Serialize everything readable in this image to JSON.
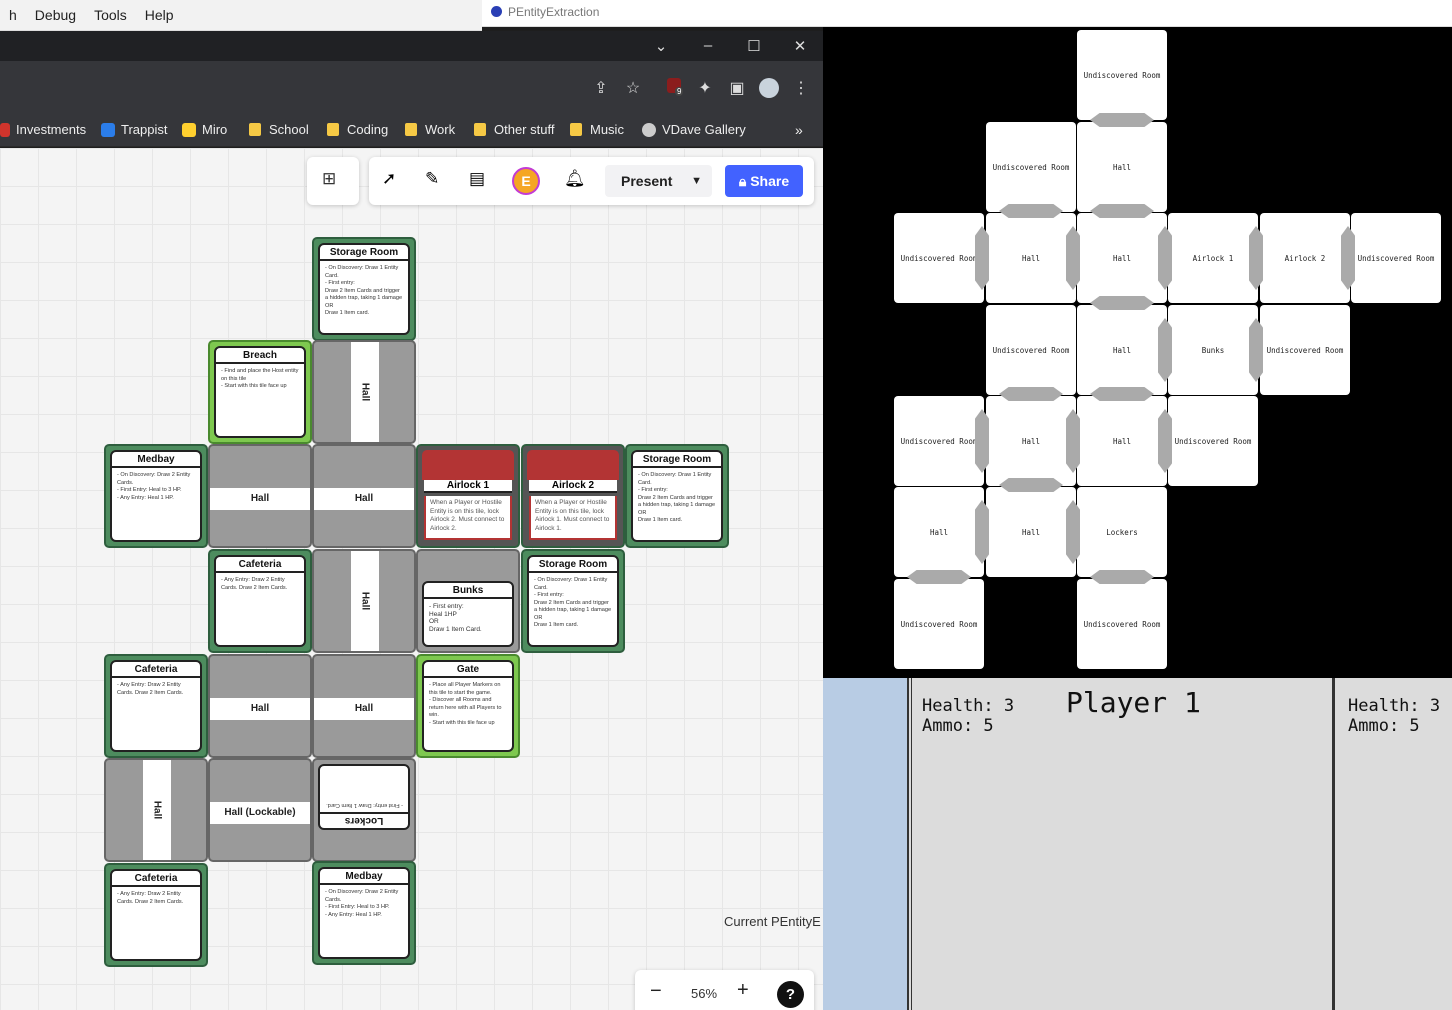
{
  "menubar": {
    "items": [
      "h",
      "Debug",
      "Tools",
      "Help"
    ]
  },
  "pe_window": {
    "title": "PEntityExtraction"
  },
  "browser": {
    "bookmarks": [
      {
        "label": "Investments",
        "icon": "investments-icon"
      },
      {
        "label": "Trappist",
        "icon": "trello-icon"
      },
      {
        "label": "Miro",
        "icon": "miro-icon"
      },
      {
        "label": "School",
        "icon": "folder-icon"
      },
      {
        "label": "Coding",
        "icon": "folder-icon"
      },
      {
        "label": "Work",
        "icon": "folder-icon"
      },
      {
        "label": "Other stuff",
        "icon": "folder-icon"
      },
      {
        "label": "Music",
        "icon": "folder-icon"
      },
      {
        "label": "VDave Gallery",
        "icon": "globe-icon"
      }
    ],
    "extension_badge": "9"
  },
  "miro": {
    "present_label": "Present",
    "share_label": "Share",
    "avatar_letter": "E",
    "zoom": "56%",
    "help": "?",
    "minus": "−",
    "plus": "+",
    "canvas_text": "Current PEntityE",
    "cards": {
      "storage1": {
        "title": "Storage Room",
        "body": "- On Discovery: Draw 1 Entity Card.\n- First entry:\nDraw 2 Item Cards and trigger a hidden trap, taking 1 damage\nOR\nDraw 1 Item card."
      },
      "breach": {
        "title": "Breach",
        "body": "- Find and place the Host entity on this tile\n- Start with this tile face up"
      },
      "medbay1": {
        "title": "Medbay",
        "body": "- On Discovery: Draw 2 Entity Cards.\n- First Entry: Heal to 3 HP.\n- Any Entry: Heal 1 HP."
      },
      "airlock1": {
        "title": "Airlock 1",
        "body": "When a Player or Hostile Entity is on this tile, lock Airlock 2. Must connect to Airlock 2."
      },
      "airlock2": {
        "title": "Airlock 2",
        "body": "When a Player or Hostile Entity is on this tile, lock Airlock 1. Must connect to Airlock 1."
      },
      "storage2": {
        "title": "Storage Room",
        "body": "- On Discovery: Draw 1 Entity Card.\n- First entry:\nDraw 2 Item Cards and trigger a hidden trap, taking 1 damage\nOR\nDraw 1 Item card."
      },
      "cafeteria1": {
        "title": "Cafeteria",
        "body": "- Any Entry: Draw 2 Entity Cards. Draw 2 Item Cards."
      },
      "bunks": {
        "title": "Bunks",
        "body": "- First entry:\nHeal 1HP\nOR\nDraw 1 Item Card."
      },
      "storage3": {
        "title": "Storage Room",
        "body": "- On Discovery: Draw 1 Entity Card.\n- First entry:\nDraw 2 Item Cards and trigger a hidden trap, taking 1 damage\nOR\nDraw 1 Item card."
      },
      "cafeteria2": {
        "title": "Cafeteria",
        "body": "- Any Entry: Draw 2 Entity Cards. Draw 2 Item Cards."
      },
      "gate": {
        "title": "Gate",
        "body": "- Place all Player Markers on this tile to start the game.\n- Discover all Rooms and return here with all Players to win.\n- Start with this tile face up"
      },
      "lockers": {
        "title": "Lockers",
        "body": "- First entry: Draw 1 Item Card."
      },
      "cafeteria3": {
        "title": "Cafeteria",
        "body": "- Any Entry: Draw 2 Entity Cards. Draw 2 Item Cards."
      },
      "medbay2": {
        "title": "Medbay",
        "body": "- On Discovery: Draw 2 Entity Cards.\n- First Entry: Heal to 3 HP.\n- Any Entry: Heal 1 HP."
      }
    },
    "halls": {
      "hall": "Hall",
      "hall_lockable": "Hall (Lockable)"
    }
  },
  "game": {
    "tiles": [
      "Undiscovered Room",
      "Hall",
      "Airlock 1",
      "Airlock 2",
      "Bunks",
      "Lockers"
    ],
    "player_title": "Player 1",
    "left_stats": {
      "health": "Health: 3",
      "ammo": "Ammo: 5"
    },
    "right_stats": {
      "health": "Health: 3",
      "ammo": "Ammo: 5"
    }
  }
}
